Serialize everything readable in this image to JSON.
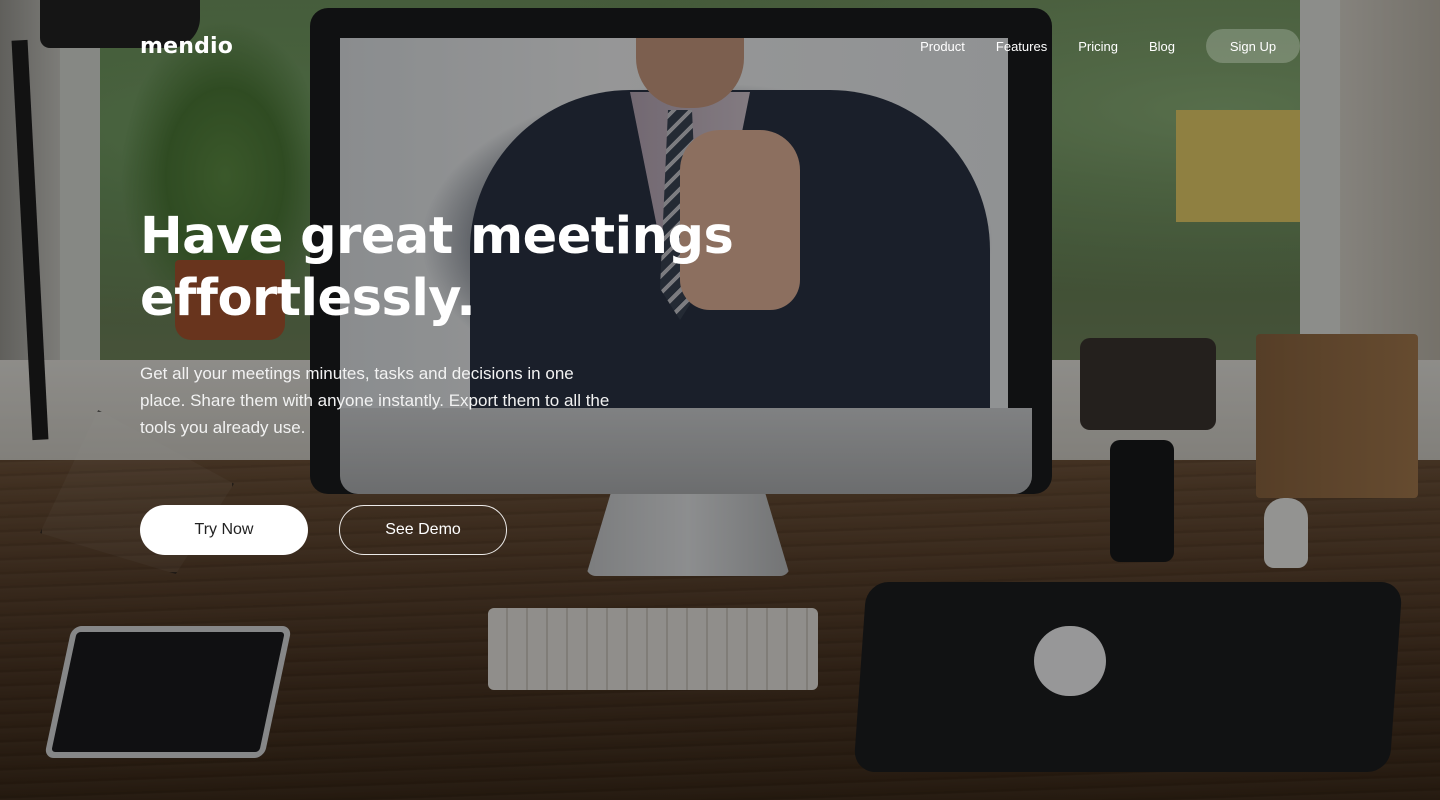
{
  "brand": {
    "logo_text": "mendio"
  },
  "nav": {
    "links": [
      {
        "label": "Product"
      },
      {
        "label": "Features"
      },
      {
        "label": "Pricing"
      },
      {
        "label": "Blog"
      }
    ],
    "signup_label": "Sign Up"
  },
  "hero": {
    "title_line1": "Have great meetings",
    "title_line2": "effortlessly.",
    "subtitle": "Get all your meetings minutes, tasks and decisions in one place. Share them with anyone instantly. Export them to all the tools you already use.",
    "primary_cta": "Try Now",
    "secondary_cta": "See Demo"
  },
  "colors": {
    "overlay": "#000000",
    "primary_button_bg": "#ffffff",
    "primary_button_text": "#222222",
    "text": "#ffffff"
  }
}
